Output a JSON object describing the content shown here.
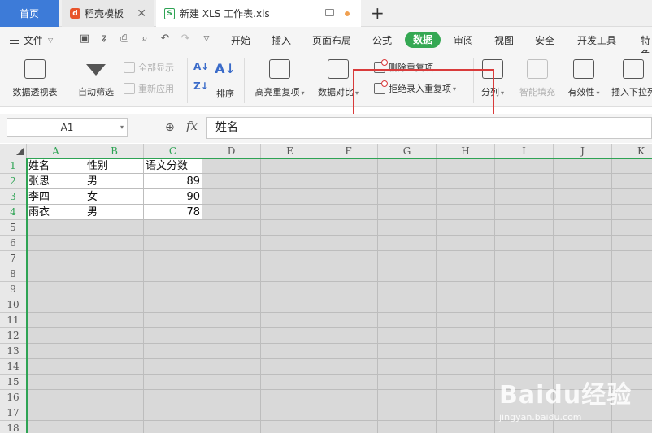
{
  "tabs": [
    {
      "label": "首页"
    },
    {
      "label": "稻壳模板",
      "icon": "daoke-icon"
    },
    {
      "label": "新建 XLS 工作表.xls",
      "icon": "spreadsheet-icon"
    }
  ],
  "menu": {
    "file": "文件",
    "items": [
      "开始",
      "插入",
      "页面布局",
      "公式",
      "数据",
      "审阅",
      "视图",
      "安全",
      "开发工具",
      "特色"
    ],
    "active": "数据"
  },
  "ribbon": {
    "pivot": "数据透视表",
    "autofilter": "自动筛选",
    "show_all": "全部显示",
    "reapply": "重新应用",
    "sort": "排序",
    "highlight_dup": "高亮重复项",
    "compare": "数据对比",
    "delete_dup": "删除重复项",
    "reject_dup": "拒绝录入重复项",
    "split": "分列",
    "flash_fill": "智能填充",
    "validity": "有效性",
    "insert_dropdown": "插入下拉列表"
  },
  "formula_bar": {
    "name_box": "A1",
    "fx": "fx",
    "content": "姓名"
  },
  "columns": [
    "A",
    "B",
    "C",
    "D",
    "E",
    "F",
    "G",
    "H",
    "I",
    "J",
    "K"
  ],
  "rows": [
    "1",
    "2",
    "3",
    "4",
    "5",
    "6",
    "7",
    "8",
    "9",
    "10",
    "11",
    "12",
    "13",
    "14",
    "15",
    "16",
    "17",
    "18"
  ],
  "table": [
    [
      "姓名",
      "性别",
      "语文分数"
    ],
    [
      "张思",
      "男",
      "89"
    ],
    [
      "李四",
      "女",
      "90"
    ],
    [
      "雨衣",
      "男",
      "78"
    ]
  ],
  "watermark": {
    "brand": "Baidu经验",
    "url": "jingyan.baidu.com"
  },
  "colors": {
    "accent_green": "#35a853",
    "home_tab": "#3d7bd8",
    "highlight_red": "#d93b3b"
  }
}
